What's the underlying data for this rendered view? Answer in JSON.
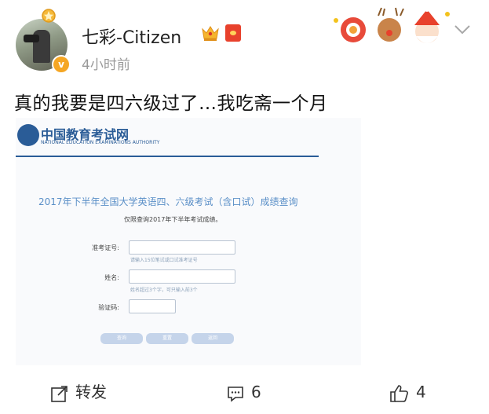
{
  "post": {
    "username": "七彩-Citizen",
    "time": "4小时前",
    "text": "真的我要是四六级过了…我吃斋一个月",
    "verified_mark": "v"
  },
  "embedded_image": {
    "logo_title": "中国教育考试网",
    "logo_subtitle": "NATIONAL EDUCATION EXAMINATIONS AUTHORITY",
    "query_title": "2017年下半年全国大学英语四、六级考试（含口试）成绩查询",
    "query_note": "仅限查询2017年下半年考试成绩。",
    "fields": [
      {
        "label": "准考证号:",
        "hint": "请输入15位笔试或口试准考证号"
      },
      {
        "label": "姓名:",
        "hint": "姓名超过3个字，可只输入前3个"
      },
      {
        "label": "验证码:",
        "hint": ""
      }
    ],
    "buttons": [
      "查询",
      "重置",
      "返回"
    ]
  },
  "actions": {
    "repost_label": "转发",
    "comment_count": "6",
    "like_count": "4"
  },
  "colors": {
    "accent_blue": "#2a5c97",
    "link_blue": "#5a8fc7",
    "verified_orange": "#f5a623",
    "red_packet": "#e8412c"
  }
}
